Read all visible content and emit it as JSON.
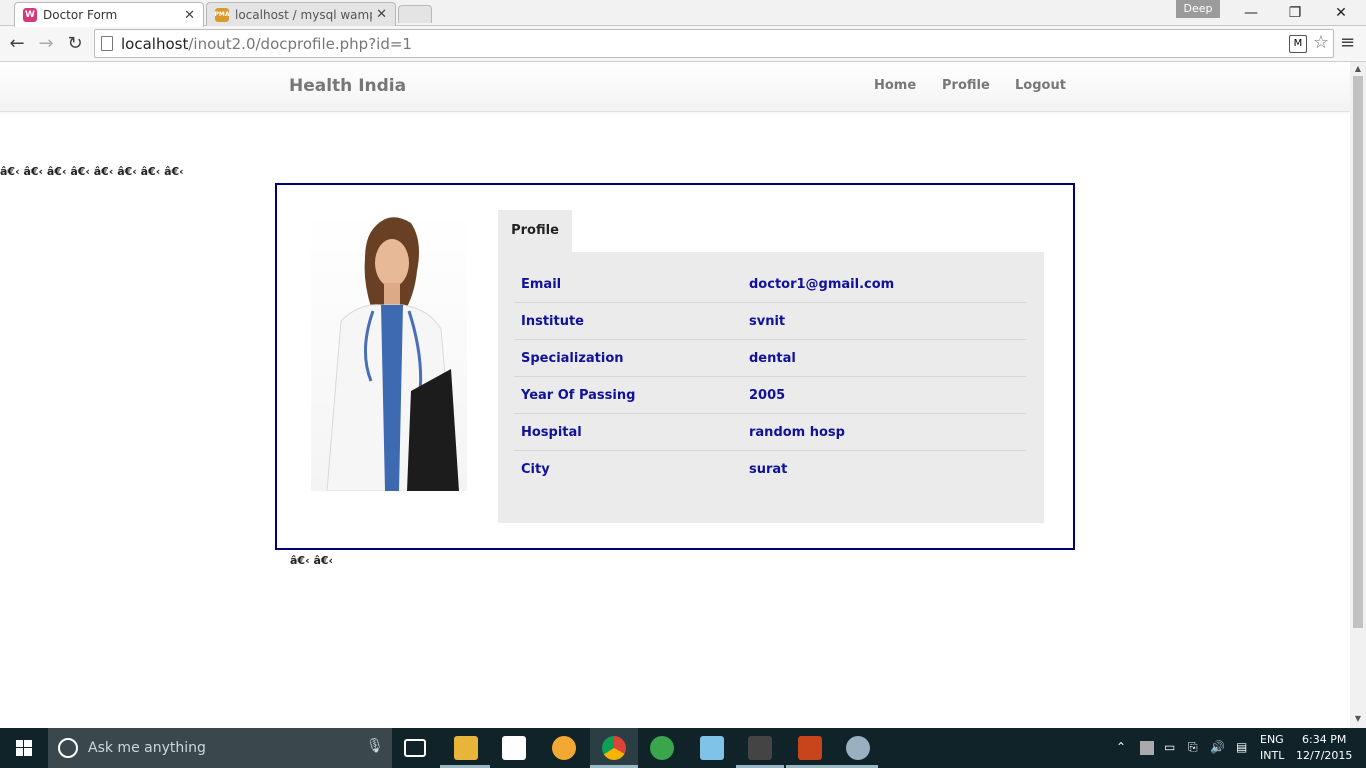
{
  "browser": {
    "tabs": [
      {
        "title": "Doctor Form",
        "favicon_color": "#d6387a",
        "favicon_text": "W"
      },
      {
        "title": "localhost / mysql wampser",
        "favicon_color": "#d89a2b",
        "favicon_text": "PMA"
      }
    ],
    "profile_name": "Deep",
    "url_host": "localhost",
    "url_path": "/inout2.0/docprofile.php?id=1"
  },
  "navbar": {
    "brand": "Health India",
    "links": [
      "Home",
      "Profile",
      "Logout"
    ]
  },
  "garbled_top": "â€‹ â€‹ â€‹ â€‹ â€‹ â€‹ â€‹ â€‹",
  "garbled_bottom": "â€‹ â€‹",
  "profile": {
    "tab_label": "Profile",
    "fields": [
      {
        "label": "Email",
        "value": "doctor1@gmail.com"
      },
      {
        "label": "Institute",
        "value": "svnit"
      },
      {
        "label": "Specialization",
        "value": "dental"
      },
      {
        "label": "Year Of Passing",
        "value": "2005"
      },
      {
        "label": "Hospital",
        "value": "random hosp"
      },
      {
        "label": "City",
        "value": "surat"
      }
    ]
  },
  "taskbar": {
    "search_placeholder": "Ask me anything",
    "lang_top": "ENG",
    "lang_bottom": "INTL",
    "time": "6:34 PM",
    "date": "12/7/2015"
  },
  "colors": {
    "card_border": "#00007a",
    "field_text": "#111199",
    "taskbar_bg": "#0f2328"
  }
}
